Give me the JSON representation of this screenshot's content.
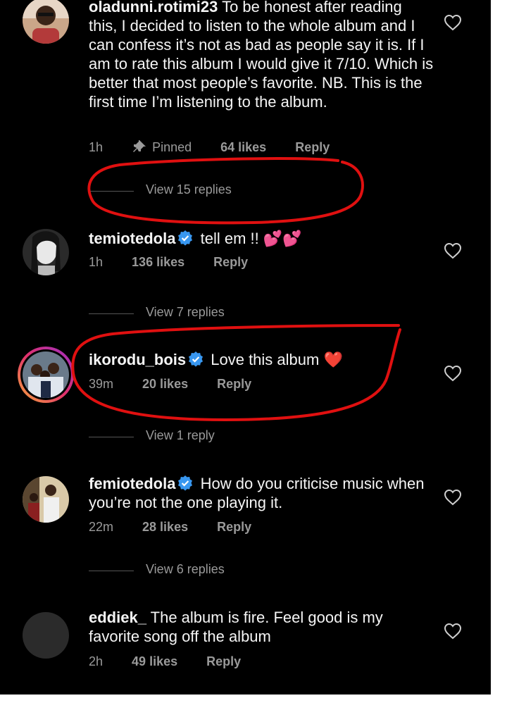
{
  "comments": [
    {
      "username": "oladunni.rotimi23",
      "verified": false,
      "body": "To be honest after reading this, I decided to listen to the whole album and I can confess it’s not as bad as people say it is. If I am to rate this album I would give it 7/10. Which is better that most people’s favorite. NB. This is the first time I’m listening to the album.",
      "time": "1h",
      "pinned_label": "Pinned",
      "likes": "64 likes",
      "reply": "Reply",
      "view_replies": "View 15 replies"
    },
    {
      "username": "temiotedola",
      "verified": true,
      "body": "tell em !! 💕💕",
      "time": "1h",
      "likes": "136 likes",
      "reply": "Reply",
      "view_replies": "View 7 replies"
    },
    {
      "username": "ikorodu_bois",
      "verified": true,
      "body": "Love this album ❤️",
      "time": "39m",
      "likes": "20 likes",
      "reply": "Reply",
      "view_replies": "View 1 reply"
    },
    {
      "username": "femiotedola",
      "verified": true,
      "body": "How do you criticise music when you’re not the one playing it.",
      "time": "22m",
      "likes": "28 likes",
      "reply": "Reply",
      "view_replies": "View 6 replies"
    },
    {
      "username": "eddiek_",
      "verified": false,
      "body": "The album is fire. Feel good is my favorite song off the album",
      "time": "2h",
      "likes": "49 likes",
      "reply": "Reply"
    }
  ],
  "icons": {
    "like": "heart-outline-icon",
    "pin": "pin-icon",
    "verified": "verified-badge-icon"
  },
  "colors": {
    "background": "#000000",
    "text": "#f5f5f5",
    "meta": "#9a9a9a",
    "verified": "#3897f0",
    "annotation": "#e01010"
  }
}
